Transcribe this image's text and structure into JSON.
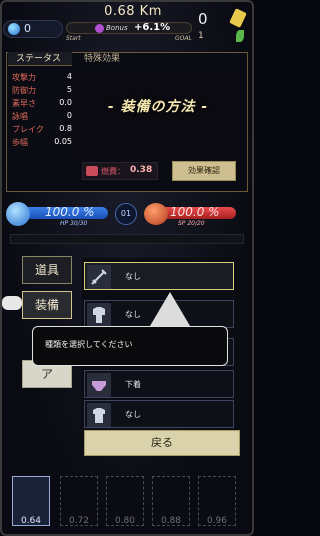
{
  "topbar": {
    "gems": "0",
    "distance": "0.68 Km",
    "start_label": "Start",
    "goal_label": "GOAL",
    "bonus_label": "Bonus",
    "bonus_value": "+6.1%",
    "coins": "0",
    "hours": "1"
  },
  "status_panel": {
    "tab_status": "ステータス",
    "tab_special": "特殊効果",
    "stats": [
      {
        "label": "攻撃力",
        "value": "4"
      },
      {
        "label": "防御力",
        "value": "5"
      },
      {
        "label": "素早さ",
        "value": "0.0"
      },
      {
        "label": "詠唱",
        "value": "0"
      },
      {
        "label": "ブレイク",
        "value": "0.8"
      },
      {
        "label": "歩幅",
        "value": "0.05"
      }
    ],
    "title": "- 装備の方法 -",
    "cost_label": "燃費：",
    "cost_value": "0.38",
    "effect_button": "効果確認"
  },
  "vitals": {
    "hp_percent": "100.0 %",
    "hp_text": "HP 30/30",
    "level": "01",
    "sp_percent": "100.0 %",
    "sp_text": "SP 20/20"
  },
  "categories": [
    "道具",
    "装備",
    "ア"
  ],
  "equipment": [
    {
      "name": "なし",
      "icon": "sword-icon"
    },
    {
      "name": "なし",
      "icon": "armor-icon"
    },
    {
      "name": "",
      "icon": "helmet-icon"
    },
    {
      "name": "下着",
      "icon": "underwear-icon"
    },
    {
      "name": "なし",
      "icon": "shirt-icon"
    }
  ],
  "tooltip": "種類を選択してください",
  "back_button": "戻る",
  "hotbar": [
    "0.64",
    "0.72",
    "0.80",
    "0.88",
    "0.96"
  ]
}
